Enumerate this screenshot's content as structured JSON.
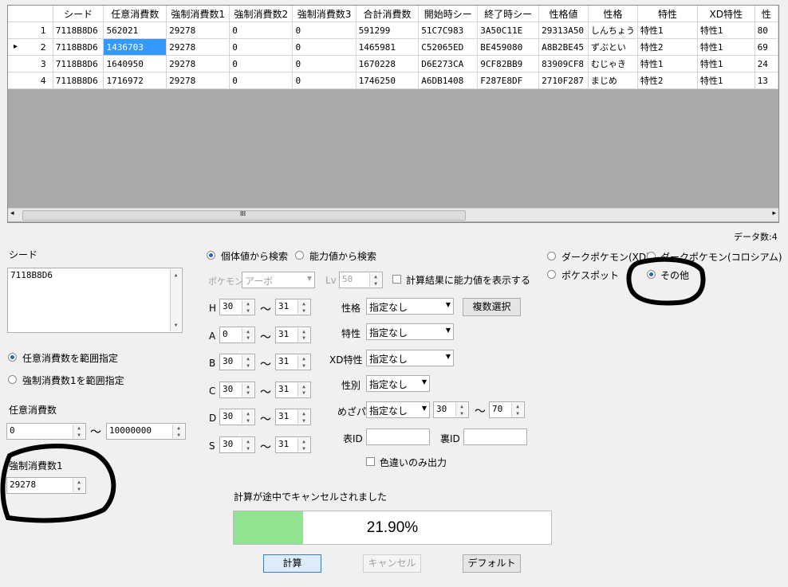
{
  "grid": {
    "columns": [
      "シード",
      "任意消費数",
      "強制消費数1",
      "強制消費数2",
      "強制消費数3",
      "合計消費数",
      "開始時シー",
      "終了時シー",
      "性格値",
      "性格",
      "特性",
      "XD特性",
      "性"
    ],
    "rows": [
      {
        "num": "1",
        "cells": [
          "7118B8D6",
          "562021",
          "29278",
          "0",
          "0",
          "591299",
          "51C7C983",
          "3A50C11E",
          "29313A50",
          "しんちょう",
          "特性1",
          "特性1",
          "80"
        ]
      },
      {
        "num": "2",
        "cells": [
          "7118B8D6",
          "1436703",
          "29278",
          "0",
          "0",
          "1465981",
          "C52065ED",
          "BE459080",
          "A8B2BE45",
          "ずぶとい",
          "特性2",
          "特性1",
          "69"
        ]
      },
      {
        "num": "3",
        "cells": [
          "7118B8D6",
          "1640950",
          "29278",
          "0",
          "0",
          "1670228",
          "D6E273CA",
          "9CF82BB9",
          "83909CF8",
          "むじゃき",
          "特性1",
          "特性1",
          "24"
        ]
      },
      {
        "num": "4",
        "cells": [
          "7118B8D6",
          "1716972",
          "29278",
          "0",
          "0",
          "1746250",
          "A6DB1408",
          "F287E8DF",
          "2710F287",
          "まじめ",
          "特性2",
          "特性1",
          "13"
        ]
      }
    ],
    "current_row_marker": "▸",
    "scroll_grip": "III"
  },
  "data_count": "データ数:4",
  "seed": {
    "label": "シード",
    "value": "7118B8D6"
  },
  "range_mode": {
    "option1": "任意消費数を範囲指定",
    "option2": "強制消費数1を範囲指定"
  },
  "optional": {
    "label": "任意消費数",
    "min": "0",
    "max": "10000000",
    "tilde": "～"
  },
  "forced1": {
    "label": "強制消費数1",
    "value": "29278"
  },
  "search_mode": {
    "by_iv": "個体値から検索",
    "by_stats": "能力値から検索"
  },
  "pokemon": {
    "label": "ポケモン",
    "value": "アーボ",
    "lv_label": "Lv",
    "lv_value": "50",
    "show_stats_label": "計算結果に能力値を表示する"
  },
  "ivs": [
    {
      "stat": "H",
      "min": "30",
      "max": "31"
    },
    {
      "stat": "A",
      "min": "0",
      "max": "31"
    },
    {
      "stat": "B",
      "min": "30",
      "max": "31"
    },
    {
      "stat": "C",
      "min": "30",
      "max": "31"
    },
    {
      "stat": "D",
      "min": "30",
      "max": "31"
    },
    {
      "stat": "S",
      "min": "30",
      "max": "31"
    }
  ],
  "filters": {
    "nature_label": "性格",
    "nature_value": "指定なし",
    "multi_select": "複数選択",
    "ability_label": "特性",
    "ability_value": "指定なし",
    "xd_ability_label": "XD特性",
    "xd_ability_value": "指定なし",
    "gender_label": "性別",
    "gender_value": "指定なし",
    "hp_label": "めざパ",
    "hp_value": "指定なし",
    "hp_min": "30",
    "hp_max": "70",
    "tid_label": "表ID",
    "tid_value": "",
    "sid_label": "裏ID",
    "sid_value": "",
    "shiny_only_label": "色違いのみ出力"
  },
  "target": {
    "dark_xd": "ダークポケモン(XD)",
    "dark_colo": "ダークポケモン(コロシアム)",
    "pokespot": "ポケスポット",
    "other": "その他"
  },
  "progress": {
    "status": "計算が途中でキャンセルされました",
    "percent_text": "21.90%",
    "fraction": 0.219
  },
  "buttons": {
    "calc": "計算",
    "cancel": "キャンセル",
    "default": "デフォルト"
  },
  "colors": {
    "progress_fill": "#90e390",
    "selection": "#3399ff",
    "annotation": "#000000"
  }
}
